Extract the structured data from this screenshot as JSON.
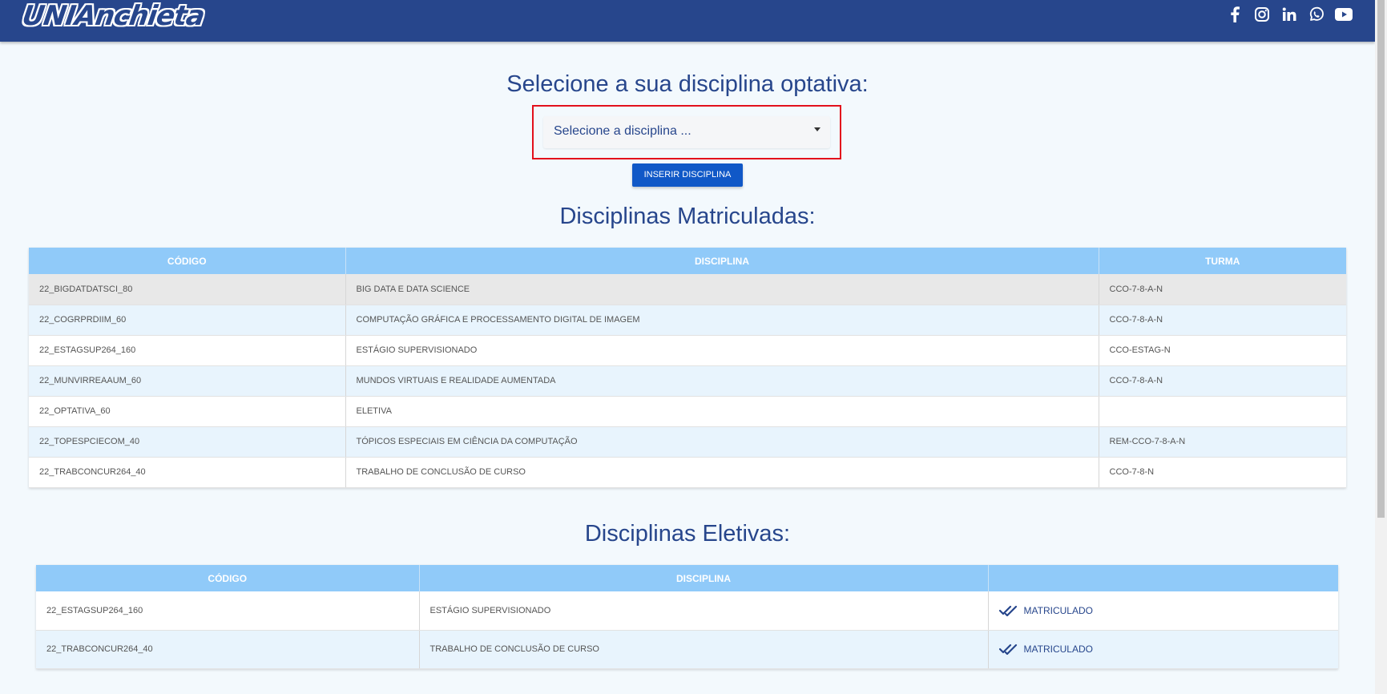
{
  "header": {
    "logo_text": "UNIAnchieta",
    "social_icons": [
      "facebook-icon",
      "instagram-icon",
      "linkedin-icon",
      "whatsapp-icon",
      "youtube-icon"
    ]
  },
  "select_section": {
    "title": "Selecione a sua disciplina optativa:",
    "select_value": "Selecione a disciplina ...",
    "button_label": "INSERIR DISCIPLINA"
  },
  "matriculadas": {
    "title": "Disciplinas Matriculadas:",
    "headers": [
      "CÓDIGO",
      "DISCIPLINA",
      "TURMA"
    ],
    "rows": [
      [
        "22_BIGDATDATSCI_80",
        "BIG DATA E DATA SCIENCE",
        "CCO-7-8-A-N"
      ],
      [
        "22_COGRPRDIIM_60",
        "COMPUTAÇÃO GRÁFICA E PROCESSAMENTO DIGITAL DE IMAGEM",
        "CCO-7-8-A-N"
      ],
      [
        "22_ESTAGSUP264_160",
        "ESTÁGIO SUPERVISIONADO",
        "CCO-ESTAG-N"
      ],
      [
        "22_MUNVIRREAAUM_60",
        "MUNDOS VIRTUAIS E REALIDADE AUMENTADA",
        "CCO-7-8-A-N"
      ],
      [
        "22_OPTATIVA_60",
        "ELETIVA",
        ""
      ],
      [
        "22_TOPESPCIECOM_40",
        "TÓPICOS ESPECIAIS EM CIÊNCIA DA COMPUTAÇÃO",
        "REM-CCO-7-8-A-N"
      ],
      [
        "22_TRABCONCUR264_40",
        "TRABALHO DE CONCLUSÃO DE CURSO",
        "CCO-7-8-N"
      ]
    ]
  },
  "eletivas": {
    "title": "Disciplinas Eletivas:",
    "headers": [
      "CÓDIGO",
      "DISCIPLINA",
      ""
    ],
    "rows": [
      [
        "22_ESTAGSUP264_160",
        "ESTÁGIO SUPERVISIONADO",
        "MATRICULADO"
      ],
      [
        "22_TRABCONCUR264_40",
        "TRABALHO DE CONCLUSÃO DE CURSO",
        "MATRICULADO"
      ]
    ]
  },
  "colors": {
    "header_bg": "#27468c",
    "table_header_bg": "#90caf9",
    "button_bg": "#1058c7",
    "highlight_border": "#e3101c"
  }
}
